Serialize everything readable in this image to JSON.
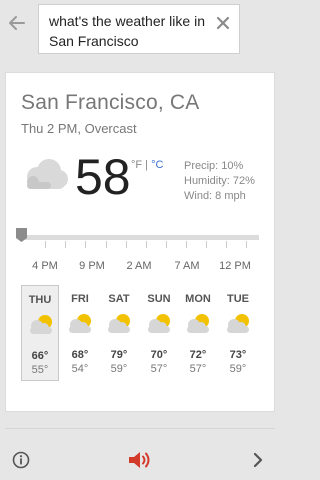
{
  "search": {
    "query": "what's the weather like in San Francisco"
  },
  "weather": {
    "location": "San Francisco, CA",
    "condition": "Thu 2 PM, Overcast",
    "temperature": "58",
    "unit_f": "°F",
    "unit_sep": " | ",
    "unit_c": "°C",
    "precip": "Precip: 10%",
    "humidity": "Humidity: 72%",
    "wind": "Wind: 8 mph",
    "hourly_labels": [
      "4 PM",
      "9 PM",
      "2 AM",
      "7 AM",
      "12 PM"
    ],
    "forecast": [
      {
        "day": "THU",
        "high": "66°",
        "low": "55°",
        "icon": "partly-cloudy-icon"
      },
      {
        "day": "FRI",
        "high": "68°",
        "low": "54°",
        "icon": "partly-cloudy-icon"
      },
      {
        "day": "SAT",
        "high": "79°",
        "low": "59°",
        "icon": "partly-cloudy-icon"
      },
      {
        "day": "SUN",
        "high": "70°",
        "low": "57°",
        "icon": "partly-cloudy-icon"
      },
      {
        "day": "MON",
        "high": "72°",
        "low": "57°",
        "icon": "partly-cloudy-icon"
      },
      {
        "day": "TUE",
        "high": "73°",
        "low": "59°",
        "icon": "partly-cloudy-icon"
      }
    ]
  },
  "colors": {
    "accent_blue": "#3b6fd1",
    "speaker_red": "#d23a2a",
    "sun_yellow": "#f2c200"
  },
  "icons": {
    "back": "arrow-left-icon",
    "clear": "close-icon",
    "info": "info-icon",
    "speaker": "speaker-icon",
    "next": "chevron-right-icon",
    "current": "cloud-icon"
  }
}
